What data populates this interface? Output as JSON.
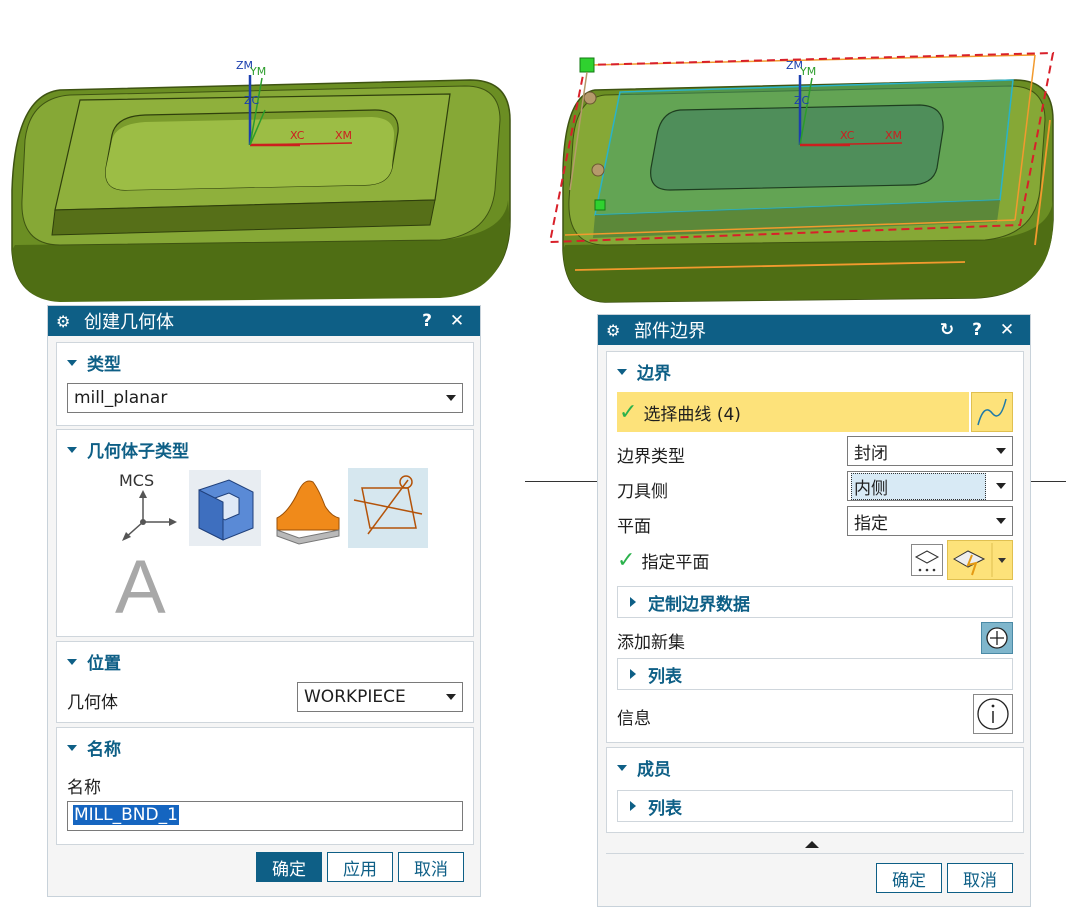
{
  "viewport_left": {
    "axes": {
      "zm": "ZM",
      "ym": "YM",
      "zc": "ZC",
      "xc": "XC",
      "xm": "XM"
    }
  },
  "viewport_right": {
    "axes": {
      "zm": "ZM",
      "ym": "YM",
      "zc": "ZC",
      "xc": "XC",
      "xm": "XM"
    }
  },
  "create_geometry": {
    "title": "创建几何体",
    "help": "?",
    "close": "✕",
    "type_section": {
      "label": "类型",
      "selected": "mill_planar"
    },
    "subtype_section": {
      "label": "几何体子类型",
      "items": [
        {
          "name": "MCS",
          "icon": "mcs-icon"
        },
        {
          "name": "WORKPIECE",
          "icon": "workpiece-icon"
        },
        {
          "name": "MILL_AREA",
          "icon": "mill-area-icon"
        },
        {
          "name": "MILL_BND",
          "icon": "mill-bnd-icon",
          "selected": true
        },
        {
          "name": "A",
          "icon": "text-a-icon"
        }
      ],
      "mcs_text": "MCS",
      "a_text": "A"
    },
    "position_section": {
      "label": "位置",
      "geometry_label": "几何体",
      "geometry_value": "WORKPIECE"
    },
    "name_section": {
      "label": "名称",
      "name_label": "名称",
      "name_value": "MILL_BND_1"
    },
    "buttons": {
      "ok": "确定",
      "apply": "应用",
      "cancel": "取消"
    }
  },
  "part_boundary": {
    "title": "部件边界",
    "reset": "↻",
    "help": "?",
    "close": "✕",
    "boundary_section": {
      "label": "边界",
      "select_curve": "选择曲线 (4)",
      "boundary_type_label": "边界类型",
      "boundary_type_value": "封闭",
      "tool_side_label": "刀具侧",
      "tool_side_value": "内侧",
      "plane_label": "平面",
      "plane_value": "指定",
      "specify_plane_label": "指定平面",
      "custom_data_label": "定制边界数据",
      "add_set_label": "添加新集",
      "list_label": "列表",
      "info_label": "信息"
    },
    "members_section": {
      "label": "成员",
      "list_label": "列表"
    },
    "buttons": {
      "ok": "确定",
      "cancel": "取消"
    },
    "colors": {
      "accent": "#0e5f86",
      "highlight": "#fde27a"
    }
  }
}
